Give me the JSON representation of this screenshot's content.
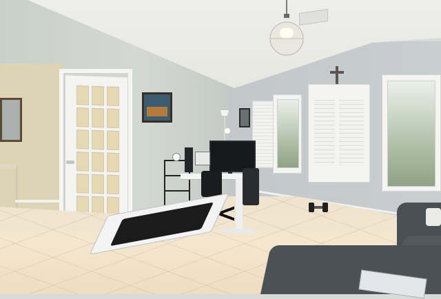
{
  "scene": {
    "description_type": "photo",
    "room": "home office",
    "colors": {
      "walls": "#c9cfc9",
      "ceiling": "#eeeeea",
      "floor_tile": "#f2e3cc",
      "sofa": "#4c5155",
      "door": "#f3f3f1"
    }
  },
  "icons": {
    "lamp": "pendant-lamp-icon",
    "cross": "wall-cross-icon",
    "dumbbell": "dumbbell-icon"
  }
}
